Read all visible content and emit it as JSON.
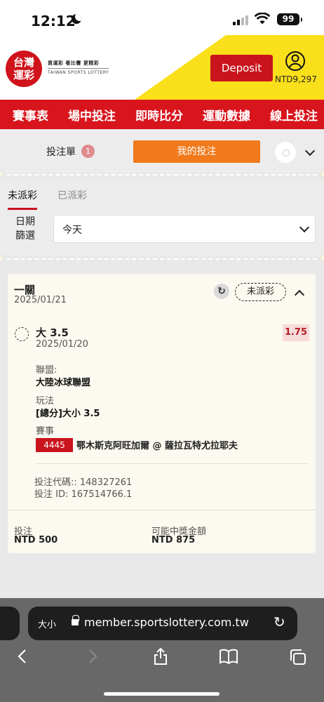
{
  "status": {
    "time": "12:12",
    "battery": "99"
  },
  "header": {
    "logo_text": "台灣運彩",
    "logo_tagline": "買運彩 看比賽 更精彩",
    "logo_en": "TAIWAN SPORTS LOTTERY",
    "deposit_label": "Deposit",
    "balance": "NTD9,297"
  },
  "nav": {
    "items": [
      "賽事表",
      "場中投注",
      "即時比分",
      "運動數據",
      "線上投注"
    ]
  },
  "betbar": {
    "slip_label": "投注單",
    "slip_count": "1",
    "my_bets_label": "我的投注"
  },
  "filter": {
    "tabs": [
      "未派彩",
      "已派彩"
    ],
    "date_label": "日期\n篩選",
    "date_value": "今天"
  },
  "bet": {
    "type": "一關",
    "date": "2025/01/21",
    "status": "未派彩",
    "selection": "大 3.5",
    "selection_date": "2025/01/20",
    "odds": "1.75",
    "league_label": "聯盟:",
    "league": "大陸冰球聯盟",
    "market_label": "玩法",
    "market": "[總分]大小 3.5",
    "event_label": "賽事",
    "event_number": "4445",
    "event_name": "鄂木斯克阿旺加爾 @ 薩拉瓦特尤拉耶夫",
    "bet_code": "投注代碼:: 148327261",
    "bet_id": "投注 ID: 167514766.1",
    "stake_label": "投注",
    "stake": "NTD 500",
    "payout_label": "可能中獎金額",
    "payout": "NTD 875"
  },
  "browser": {
    "text_size": "大小",
    "url": "member.sportslottery.com.tw"
  }
}
